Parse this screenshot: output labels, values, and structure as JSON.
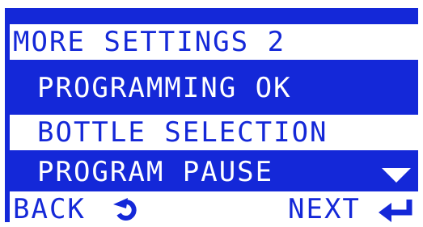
{
  "menu": {
    "title": "MORE SETTINGS 2",
    "items": [
      {
        "label": "PROGRAMMING OK",
        "selected": false
      },
      {
        "label": "BOTTLE SELECTION",
        "selected": true
      },
      {
        "label": "PROGRAM PAUSE",
        "selected": false
      }
    ]
  },
  "footer": {
    "back_label": "BACK",
    "next_label": "NEXT"
  },
  "icons": {
    "back": "back-arrow-icon",
    "enter": "enter-return-icon",
    "scroll": "scroll-down-triangle-icon"
  },
  "colors": {
    "screen_blue": "#1428d8",
    "highlight": "#ffffff"
  }
}
